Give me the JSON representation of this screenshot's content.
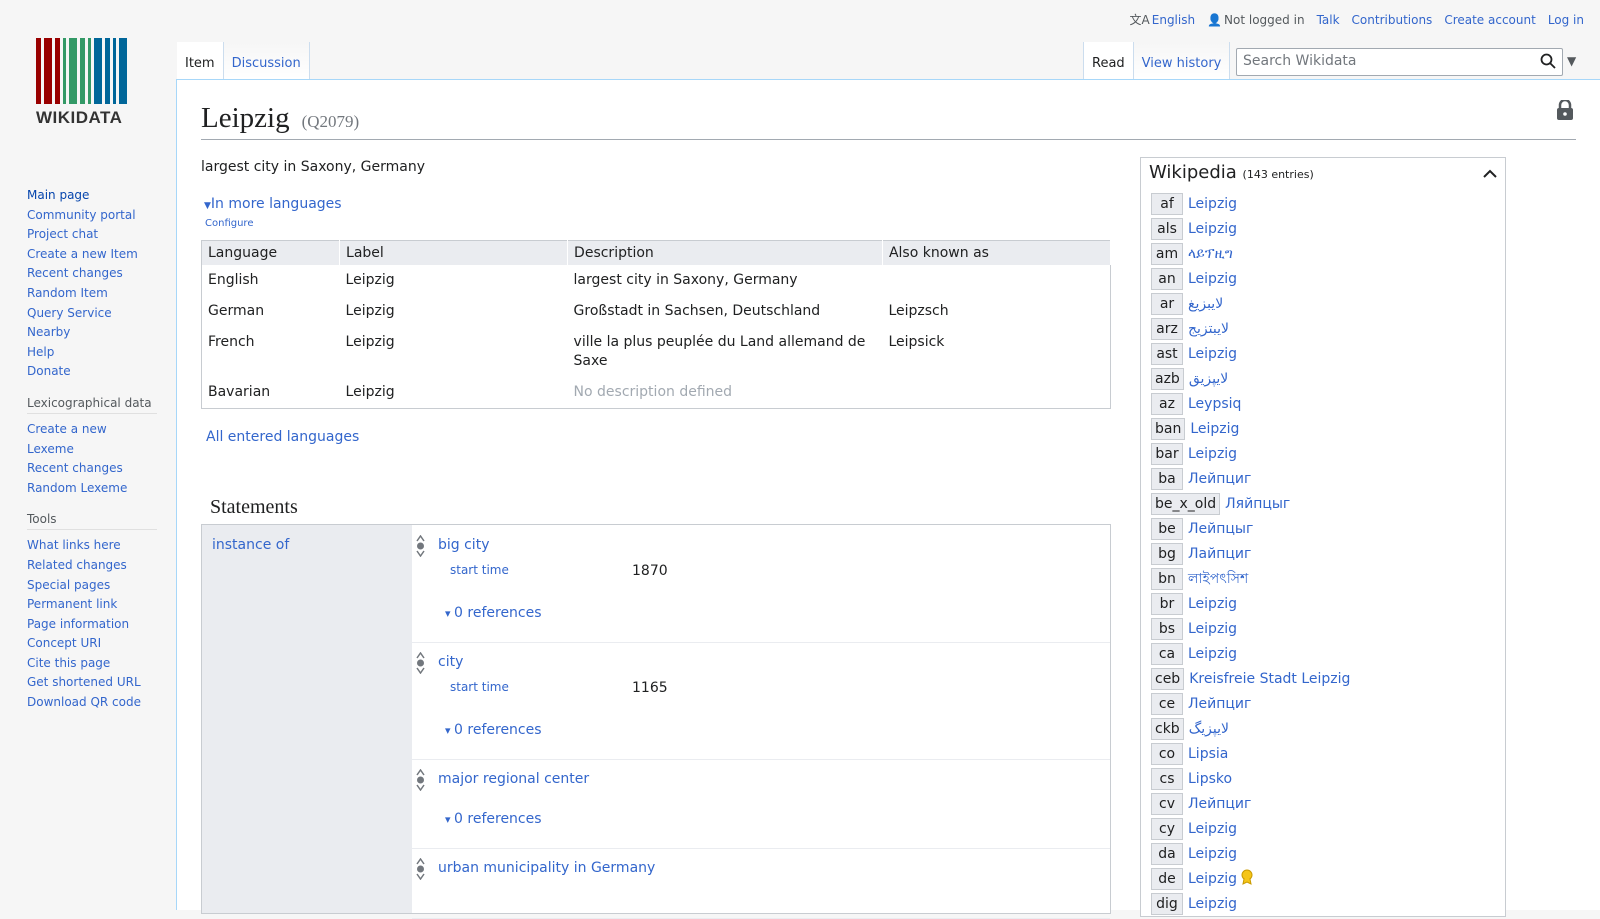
{
  "personal": {
    "language": "English",
    "status": "Not logged in",
    "talk": "Talk",
    "contributions": "Contributions",
    "create_account": "Create account",
    "login": "Log in"
  },
  "logo": {
    "word": "WIKIDATA"
  },
  "sidebar": {
    "main": [
      "Main page",
      "Community portal",
      "Project chat",
      "Create a new Item",
      "Recent changes",
      "Random Item",
      "Query Service",
      "Nearby",
      "Help",
      "Donate"
    ],
    "lex_title": "Lexicographical data",
    "lex": [
      "Create a new Lexeme",
      "Recent changes",
      "Random Lexeme"
    ],
    "tools_title": "Tools",
    "tools": [
      "What links here",
      "Related changes",
      "Special pages",
      "Permanent link",
      "Page information",
      "Concept URI",
      "Cite this page",
      "Get shortened URL",
      "Download QR code"
    ]
  },
  "tabs": {
    "item": "Item",
    "discussion": "Discussion",
    "read": "Read",
    "history": "View history"
  },
  "search": {
    "placeholder": "Search Wikidata"
  },
  "item": {
    "label": "Leipzig",
    "qid": "(Q2079)",
    "description": "largest city in Saxony, Germany"
  },
  "languages": {
    "more": "In more languages",
    "configure": "Configure",
    "headers": [
      "Language",
      "Label",
      "Description",
      "Also known as"
    ],
    "rows": [
      {
        "lang": "English",
        "label": "Leipzig",
        "desc": "largest city in Saxony, Germany",
        "aka": ""
      },
      {
        "lang": "German",
        "label": "Leipzig",
        "desc": "Großstadt in Sachsen, Deutschland",
        "aka": "Leipzsch"
      },
      {
        "lang": "French",
        "label": "Leipzig",
        "desc": "ville la plus peuplée du Land allemand de Saxe",
        "aka": "Leipsick"
      },
      {
        "lang": "Bavarian",
        "label": "Leipzig",
        "desc": "No description defined",
        "aka": ""
      }
    ],
    "all": "All entered languages"
  },
  "statements": {
    "heading": "Statements",
    "property": "instance of",
    "claims": [
      {
        "value": "big city",
        "qualifier": "start time",
        "qvalue": "1870",
        "refs": "0 references"
      },
      {
        "value": "city",
        "qualifier": "start time",
        "qvalue": "1165",
        "refs": "0 references"
      },
      {
        "value": "major regional center",
        "refs": "0 references"
      },
      {
        "value": "urban municipality in Germany"
      }
    ]
  },
  "wikipedia": {
    "title": "Wikipedia",
    "count": "(143 entries)",
    "links": [
      {
        "code": "af",
        "title": "Leipzig"
      },
      {
        "code": "als",
        "title": "Leipzig"
      },
      {
        "code": "am",
        "title": "ላይፕዚግ"
      },
      {
        "code": "an",
        "title": "Leipzig"
      },
      {
        "code": "ar",
        "title": "لايبزيغ"
      },
      {
        "code": "arz",
        "title": "لايبتزيج"
      },
      {
        "code": "ast",
        "title": "Leipzig"
      },
      {
        "code": "azb",
        "title": "لایپزیق"
      },
      {
        "code": "az",
        "title": "Leypsiq"
      },
      {
        "code": "ban",
        "title": "Leipzig"
      },
      {
        "code": "bar",
        "title": "Leipzig"
      },
      {
        "code": "ba",
        "title": "Лейпциг"
      },
      {
        "code": "be_x_old",
        "title": "Ляйпцыг"
      },
      {
        "code": "be",
        "title": "Лейпцыг"
      },
      {
        "code": "bg",
        "title": "Лайпциг"
      },
      {
        "code": "bn",
        "title": "লাইপৎসিশ"
      },
      {
        "code": "br",
        "title": "Leipzig"
      },
      {
        "code": "bs",
        "title": "Leipzig"
      },
      {
        "code": "ca",
        "title": "Leipzig"
      },
      {
        "code": "ceb",
        "title": "Kreisfreie Stadt Leipzig"
      },
      {
        "code": "ce",
        "title": "Лейпциг"
      },
      {
        "code": "ckb",
        "title": "لایپزیگ"
      },
      {
        "code": "co",
        "title": "Lipsia"
      },
      {
        "code": "cs",
        "title": "Lipsko"
      },
      {
        "code": "cv",
        "title": "Лейпциг"
      },
      {
        "code": "cy",
        "title": "Leipzig"
      },
      {
        "code": "da",
        "title": "Leipzig"
      },
      {
        "code": "de",
        "title": "Leipzig",
        "badge": "good-article-icon"
      },
      {
        "code": "dig",
        "title": "Leipzig"
      }
    ]
  }
}
